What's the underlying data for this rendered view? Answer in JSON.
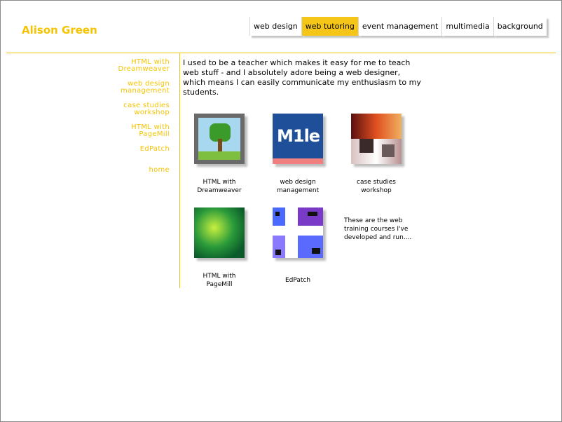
{
  "site": {
    "title": "Alison Green"
  },
  "top_nav": [
    {
      "label": "web design",
      "active": false
    },
    {
      "label": "web tutoring",
      "active": true
    },
    {
      "label": "event management",
      "active": false
    },
    {
      "label": "multimedia",
      "active": false
    },
    {
      "label": "background",
      "active": false
    }
  ],
  "side_nav": [
    {
      "line1": "HTML with",
      "line2": "Dreamweaver"
    },
    {
      "line1": "web design",
      "line2": "management"
    },
    {
      "line1": "case studies",
      "line2": "workshop"
    },
    {
      "line1": "HTML with",
      "line2": "PageMill"
    },
    {
      "line1": "EdPatch",
      "line2": ""
    },
    {
      "line1": "home",
      "line2": ""
    }
  ],
  "intro": "I used to be a teacher which makes it easy for me to teach web stuff - and I absolutely adore being a web designer, which means I can easily communicate my enthusiasm to my students.",
  "courses": [
    {
      "line1": "HTML with",
      "line2": "Dreamweaver",
      "icon": "dreamweaver-tree-thumbnail"
    },
    {
      "line1": "web design",
      "line2": "management",
      "icon": "web-design-thumbnail"
    },
    {
      "line1": "case studies",
      "line2": "workshop",
      "icon": "case-studies-thumbnail"
    },
    {
      "line1": "HTML with",
      "line2": "PageMill",
      "icon": "pagemill-thumbnail"
    },
    {
      "line1": "EdPatch",
      "line2": "",
      "icon": "edpatch-thumbnail"
    }
  ],
  "note": "These are the web training courses I've developed and run....",
  "colors": {
    "accent": "#f5c400",
    "active_tab": "#f5c518"
  }
}
